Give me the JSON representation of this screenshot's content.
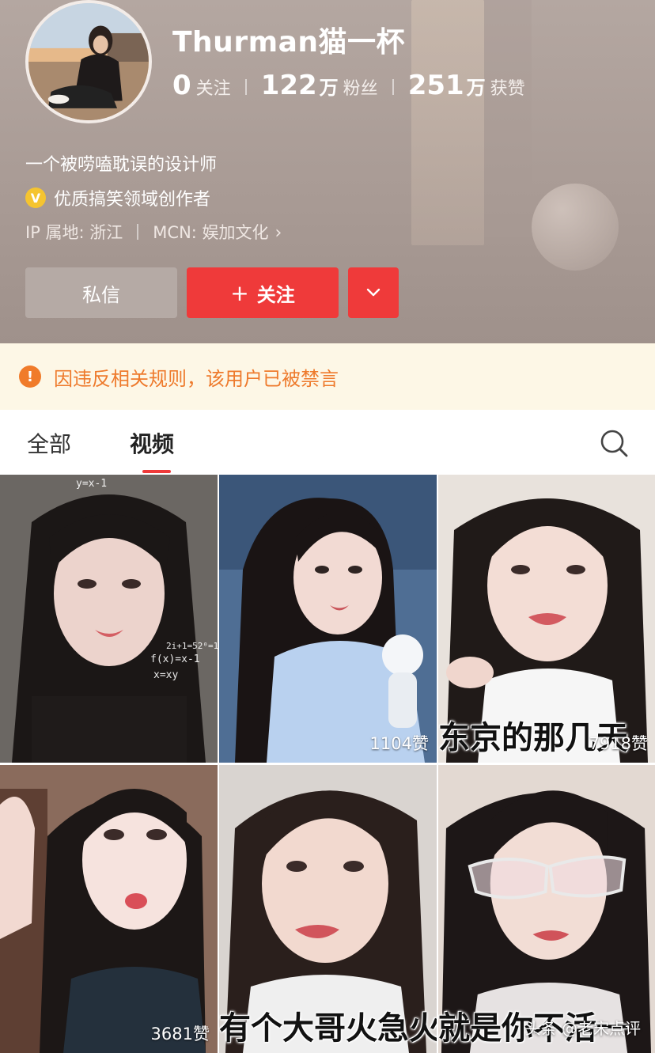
{
  "profile": {
    "username": "Thurman猫一杯",
    "stats": {
      "following_num": "0",
      "following_label": "关注",
      "followers_num": "122",
      "followers_unit": "万",
      "followers_label": "粉丝",
      "likes_num": "251",
      "likes_unit": "万",
      "likes_label": "获赞"
    },
    "bio": "一个被唠嗑耽误的设计师",
    "certification": {
      "icon": "v-badge-icon",
      "icon_text": "V",
      "text": "优质搞笑领域创作者",
      "color": "#f5c430"
    },
    "ip_location": "IP 属地: 浙江",
    "mcn": "MCN: 娱加文化",
    "mcn_chevron": "›"
  },
  "actions": {
    "message_label": "私信",
    "follow_plus": "+",
    "follow_label": "关注",
    "more_icon": "chevron-down-icon",
    "accent_color": "#ef3a3a"
  },
  "notice": {
    "icon": "warning-icon",
    "icon_text": "!",
    "text": "因违反相关规则，该用户已被禁言",
    "color": "#ee7a2c"
  },
  "tabs": {
    "items": [
      {
        "label": "全部"
      },
      {
        "label": "视频"
      }
    ],
    "active": "视频",
    "search_icon": "search-icon"
  },
  "videos": [
    {
      "likes": "",
      "caption": ""
    },
    {
      "likes": "1104赞",
      "caption": ""
    },
    {
      "likes": "7918赞",
      "caption": "东京的那几天"
    },
    {
      "likes": "3681赞",
      "caption": ""
    },
    {
      "likes": "",
      "caption": "有个大哥火急火燎"
    },
    {
      "likes": "",
      "caption": "就是你不活一"
    }
  ],
  "formula_overlay": {
    "line1": "y=x-1",
    "line2": "f(x)=x-1",
    "line3": "2i+1=52⁰=1",
    "line4": "x=xy"
  },
  "watermark": "头条 @老宋点评"
}
